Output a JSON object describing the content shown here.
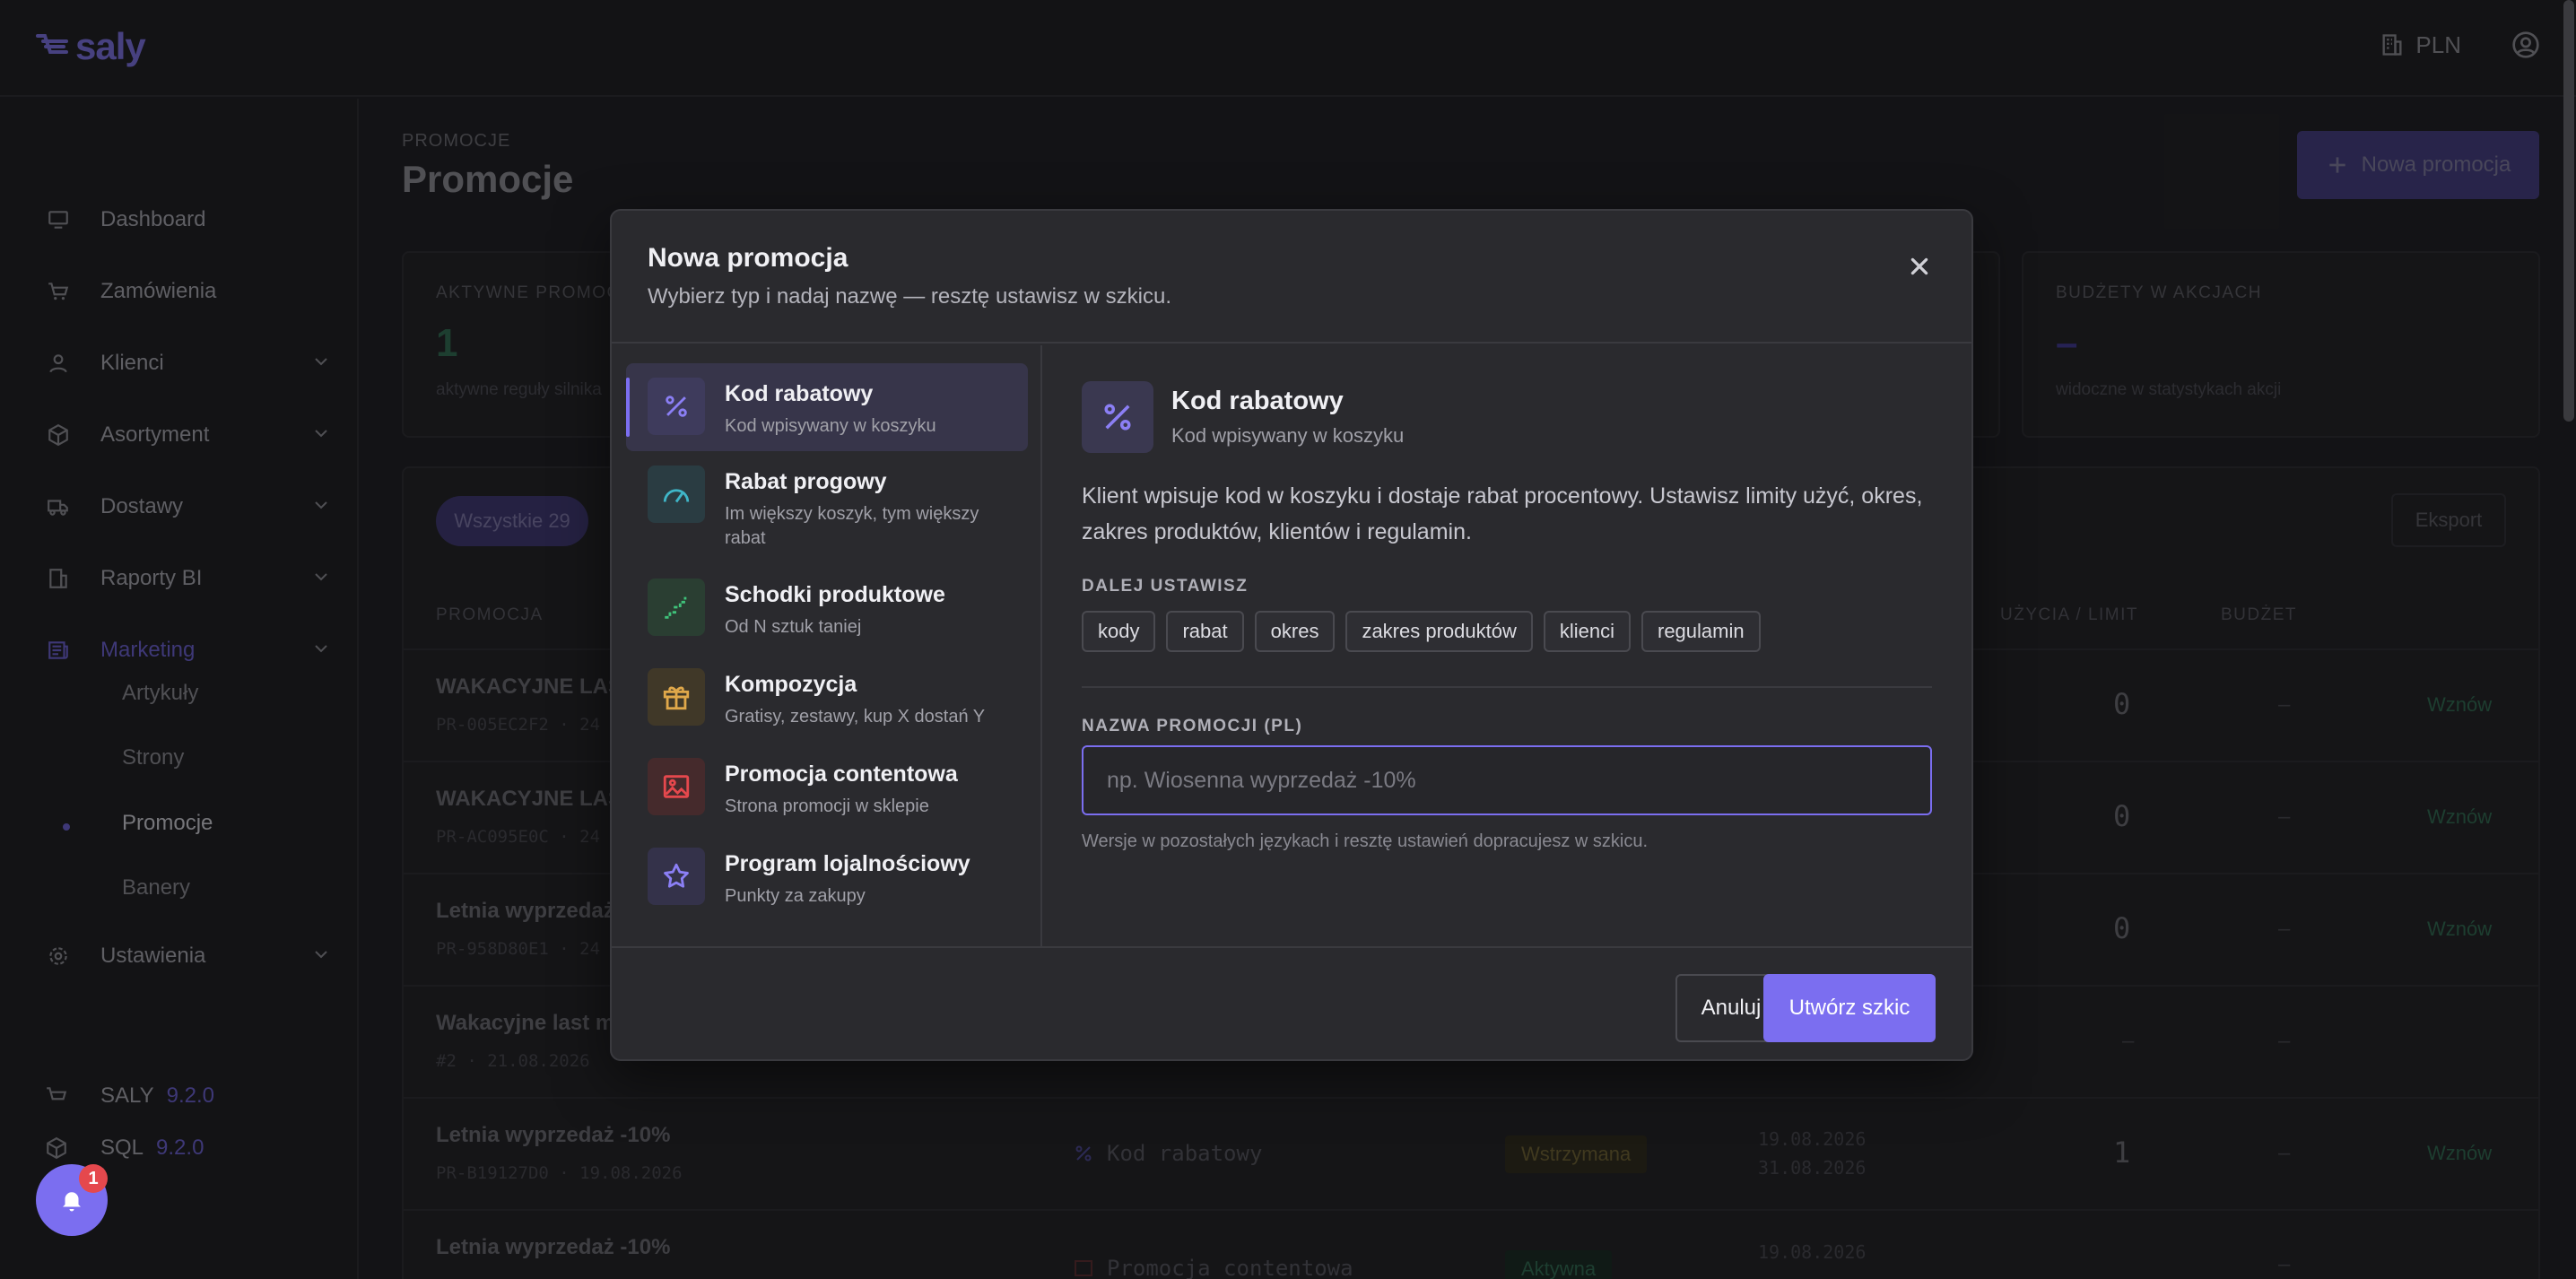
{
  "app": {
    "logo": "saly"
  },
  "topbar": {
    "currency": "PLN"
  },
  "sidebar": {
    "items": [
      {
        "label": "Dashboard"
      },
      {
        "label": "Zamówienia"
      },
      {
        "label": "Klienci"
      },
      {
        "label": "Asortyment"
      },
      {
        "label": "Dostawy"
      },
      {
        "label": "Raporty BI"
      },
      {
        "label": "Marketing"
      },
      {
        "label": "Ustawienia"
      }
    ],
    "marketing_sub": [
      {
        "label": "Artykuły"
      },
      {
        "label": "Strony"
      },
      {
        "label": "Promocje"
      },
      {
        "label": "Banery"
      }
    ],
    "versions": [
      {
        "name": "SALY",
        "version": "9.2.0"
      },
      {
        "name": "SQL",
        "version": "9.2.0"
      }
    ]
  },
  "page": {
    "breadcrumb": "PROMOCJE",
    "title": "Promocje",
    "new_button": "Nowa promocja"
  },
  "stats": [
    {
      "label": "AKTYWNE PROMOCJE",
      "value": "1",
      "sub": "aktywne reguły silnika"
    },
    {
      "label": "BUDŻETY W AKCJACH",
      "value": "–",
      "sub": "widoczne w statystykach akcji"
    }
  ],
  "table": {
    "filter_all": "Wszystkie 29",
    "export": "Eksport",
    "headers": {
      "promo": "PROMOCJA",
      "usage": "UŻYCIA / LIMIT",
      "budget": "BUDŻET"
    },
    "rows": [
      {
        "title": "WAKACYJNE LAS",
        "code": "PR-005EC2F2 · 24",
        "usage": "0",
        "budget": "–",
        "action": "Wznów"
      },
      {
        "title": "WAKACYJNE LAS",
        "code": "PR-AC095E0C · 24",
        "usage": "0",
        "budget": "–",
        "action": "Wznów"
      },
      {
        "title": "Letnia wyprzedaż",
        "code": "PR-958D80E1 · 24",
        "usage": "0",
        "budget": "–",
        "action": "Wznów"
      },
      {
        "title": "Wakacyjne last m",
        "code": "#2 · 21.08.2026",
        "usage": "–",
        "budget": "–",
        "action": ""
      },
      {
        "title": "Letnia wyprzedaż -10%",
        "code": "PR-B19127D0 · 19.08.2026",
        "type": "Kod rabatowy",
        "status": "Wstrzymana",
        "date_from": "19.08.2026",
        "date_to": "31.08.2026",
        "usage": "1",
        "budget": "–",
        "action": "Wznów"
      },
      {
        "title": "Letnia wyprzedaż -10%",
        "code": "",
        "type": "Promocja contentowa",
        "status": "Aktywna",
        "date_from": "19.08.2026",
        "usage": "",
        "budget": "–",
        "action": ""
      }
    ]
  },
  "modal": {
    "title": "Nowa promocja",
    "subtitle": "Wybierz typ i nadaj nazwę — resztę ustawisz w szkicu.",
    "types": [
      {
        "name": "Kod rabatowy",
        "desc": "Kod wpisywany w koszyku",
        "icon": "percent-icon",
        "color": "#7b6ef0"
      },
      {
        "name": "Rabat progowy",
        "desc": "Im większy koszyk, tym większy rabat",
        "icon": "gauge-icon",
        "color": "#3fb6c8"
      },
      {
        "name": "Schodki produktowe",
        "desc": "Od N sztuk taniej",
        "icon": "stairs-icon",
        "color": "#3fc27a"
      },
      {
        "name": "Kompozycja",
        "desc": "Gratisy, zestawy, kup X dostań Y",
        "icon": "gift-icon",
        "color": "#e0a84a"
      },
      {
        "name": "Promocja contentowa",
        "desc": "Strona promocji w sklepie",
        "icon": "image-icon",
        "color": "#e5484d"
      },
      {
        "name": "Program lojalnościowy",
        "desc": "Punkty za zakupy",
        "icon": "star-icon",
        "color": "#7b6ef0"
      }
    ],
    "detail": {
      "title": "Kod rabatowy",
      "subtitle": "Kod wpisywany w koszyku",
      "description": "Klient wpisuje kod w koszyku i dostaje rabat procentowy. Ustawisz limity użyć, okres, zakres produktów, klientów i regulamin.",
      "next_label": "DALEJ USTAWISZ",
      "tags": [
        "kody",
        "rabat",
        "okres",
        "zakres produktów",
        "klienci",
        "regulamin"
      ],
      "name_label": "NAZWA PROMOCJI (PL)",
      "name_value": "",
      "name_placeholder": "np. Wiosenna wyprzedaż -10%",
      "hint": "Wersje w pozostałych językach i resztę ustawień dopracujesz w szkicu."
    },
    "cancel": "Anuluj",
    "create": "Utwórz szkic"
  },
  "notifications": {
    "count": "1"
  }
}
